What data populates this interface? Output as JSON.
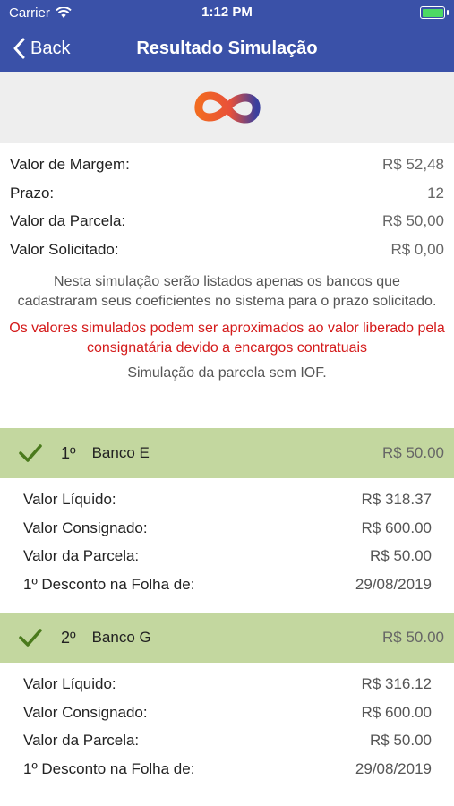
{
  "status_bar": {
    "carrier": "Carrier",
    "time": "1:12 PM"
  },
  "nav": {
    "back_label": "Back",
    "title": "Resultado Simulação"
  },
  "summary": [
    {
      "label": "Valor de Margem:",
      "value": "R$ 52,48"
    },
    {
      "label": "Prazo:",
      "value": "12"
    },
    {
      "label": "Valor da Parcela:",
      "value": "R$ 50,00"
    },
    {
      "label": "Valor Solicitado:",
      "value": "R$ 0,00"
    }
  ],
  "note": "Nesta simulação serão listados apenas os bancos que cadastraram seus coeficientes no sistema para o prazo solicitado.",
  "warning": "Os valores simulados podem ser aproximados ao valor liberado pela consignatária devido a encargos contratuais",
  "iof_note": "Simulação da parcela sem IOF.",
  "banks": [
    {
      "rank": "1º",
      "name": "Banco E",
      "amount": "R$ 50.00",
      "details": [
        {
          "label": "Valor Líquido:",
          "value": "R$ 318.37"
        },
        {
          "label": "Valor Consignado:",
          "value": "R$ 600.00"
        },
        {
          "label": "Valor da Parcela:",
          "value": "R$ 50.00"
        },
        {
          "label": "1º Desconto na Folha de:",
          "value": "29/08/2019"
        }
      ]
    },
    {
      "rank": "2º",
      "name": "Banco G",
      "amount": "R$ 50.00",
      "details": [
        {
          "label": "Valor Líquido:",
          "value": "R$ 316.12"
        },
        {
          "label": "Valor Consignado:",
          "value": "R$ 600.00"
        },
        {
          "label": "Valor da Parcela:",
          "value": "R$ 50.00"
        },
        {
          "label": "1º Desconto na Folha de:",
          "value": "29/08/2019"
        }
      ]
    }
  ],
  "colors": {
    "nav_bg": "#3a51a8",
    "bank_header_bg": "#c3d79f",
    "check": "#4a7a1c",
    "warning": "#d41a1a"
  }
}
